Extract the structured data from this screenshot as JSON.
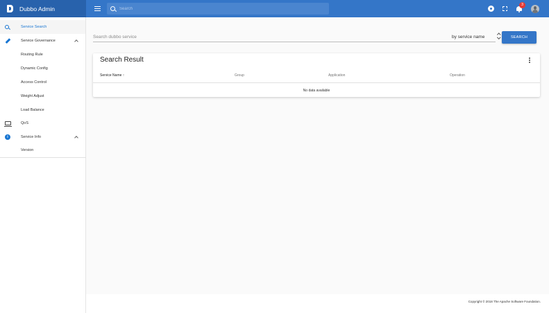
{
  "app": {
    "title": "Dubbo Admin"
  },
  "topbar": {
    "search_placeholder": "Search",
    "notification_count": "3"
  },
  "sidebar": {
    "items": [
      {
        "label": "Service Search"
      },
      {
        "label": "Service Governance"
      },
      {
        "label": "Routing Rule"
      },
      {
        "label": "Dynamic Config"
      },
      {
        "label": "Access Control"
      },
      {
        "label": "Weight Adjust"
      },
      {
        "label": "Load Balance"
      },
      {
        "label": "QoS"
      },
      {
        "label": "Service Info"
      },
      {
        "label": "Version"
      }
    ]
  },
  "main": {
    "search_placeholder": "Search dubbo service",
    "search_by": "by service name",
    "search_button": "SEARCH",
    "result_title": "Search Result",
    "columns": [
      "Service Name ↑",
      "Group",
      "Application",
      "Operation"
    ],
    "empty_text": "No data available"
  },
  "footer": {
    "copyright": "Copyright © 2018 The Apache Software Foundation."
  },
  "colors": {
    "appbar": "#3476c8",
    "brand": "#2862ac",
    "accent": "#1976d2",
    "badge": "#e53935"
  }
}
